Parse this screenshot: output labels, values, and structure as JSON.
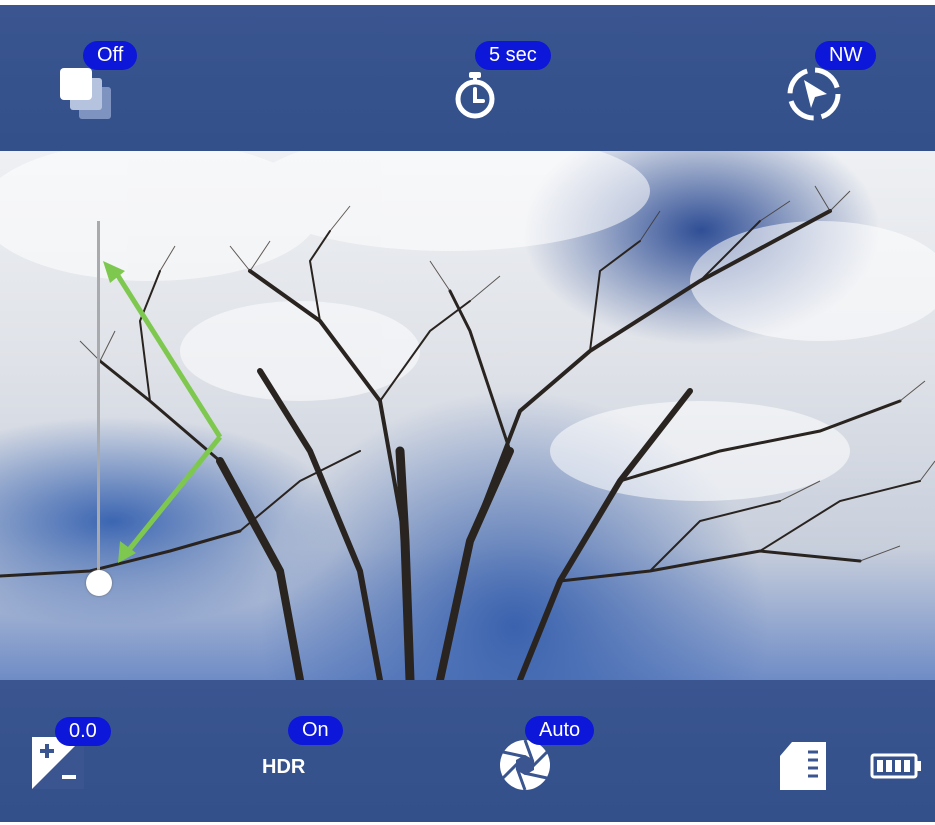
{
  "top_controls": {
    "multi_shot": {
      "icon": "layers-icon",
      "badge": "Off"
    },
    "self_timer": {
      "icon": "timer-icon",
      "badge": "5 sec"
    },
    "orientation": {
      "icon": "compass-arrow-icon",
      "badge": "NW"
    }
  },
  "bottom_controls": {
    "exposure": {
      "icon": "exposure-compensation-icon",
      "badge": "0.0"
    },
    "hdr": {
      "label": "HDR",
      "badge": "On"
    },
    "aperture": {
      "icon": "aperture-icon",
      "badge": "Auto"
    },
    "storage": {
      "icon": "sd-card-icon"
    },
    "battery": {
      "icon": "battery-icon"
    }
  },
  "colors": {
    "bar": "#3a5590",
    "badge": "#0c17d9",
    "annotation_arrow": "#7ec850"
  },
  "exposure_slider": {
    "value_fraction": 0.0
  }
}
